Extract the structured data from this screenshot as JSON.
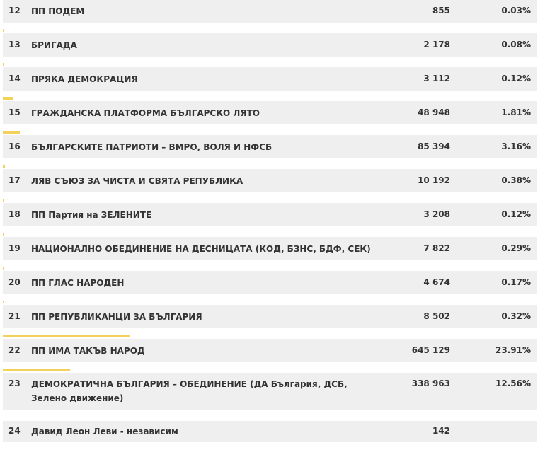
{
  "rows": [
    {
      "num": "12",
      "name": "ПП ПОДЕМ",
      "votes": "855",
      "pct": "0.03%",
      "share": 0.03
    },
    {
      "num": "13",
      "name": "БРИГАДА",
      "votes": "2 178",
      "pct": "0.08%",
      "share": 0.08
    },
    {
      "num": "14",
      "name": "ПРЯКА ДЕМОКРАЦИЯ",
      "votes": "3 112",
      "pct": "0.12%",
      "share": 0.12
    },
    {
      "num": "15",
      "name": "ГРАЖДАНСКА ПЛАТФОРМА БЪЛГАРСКО ЛЯТО",
      "votes": "48 948",
      "pct": "1.81%",
      "share": 1.81
    },
    {
      "num": "16",
      "name": "БЪЛГАРСКИТЕ ПАТРИОТИ – ВМРО, ВОЛЯ И НФСБ",
      "votes": "85 394",
      "pct": "3.16%",
      "share": 3.16
    },
    {
      "num": "17",
      "name": "ЛЯВ СЪЮЗ ЗА ЧИСТА И СВЯТА РЕПУБЛИКА",
      "votes": "10 192",
      "pct": "0.38%",
      "share": 0.38
    },
    {
      "num": "18",
      "name": "ПП Партия на ЗЕЛЕНИТЕ",
      "votes": "3 208",
      "pct": "0.12%",
      "share": 0.12
    },
    {
      "num": "19",
      "name": "НАЦИОНАЛНО ОБЕДИНЕНИЕ НА ДЕСНИЦАТА (КОД, БЗНС, БДФ, СЕК)",
      "votes": "7 822",
      "pct": "0.29%",
      "share": 0.29
    },
    {
      "num": "20",
      "name": "ПП ГЛАС НАРОДЕН",
      "votes": "4 674",
      "pct": "0.17%",
      "share": 0.17
    },
    {
      "num": "21",
      "name": "ПП РЕПУБЛИКАНЦИ ЗА БЪЛГАРИЯ",
      "votes": "8 502",
      "pct": "0.32%",
      "share": 0.32
    },
    {
      "num": "22",
      "name": "ПП ИМА ТАКЪВ НАРОД",
      "votes": "645 129",
      "pct": "23.91%",
      "share": 23.91
    },
    {
      "num": "23",
      "name": "ДЕМОКРАТИЧНА БЪЛГАРИЯ – ОБЕДИНЕНИЕ (ДА България, ДСБ, Зелено движение)",
      "votes": "338 963",
      "pct": "12.56%",
      "share": 12.56
    },
    {
      "num": "24",
      "name": "Давид Леон Леви - независим",
      "votes": "142",
      "pct": "",
      "share": null
    }
  ],
  "colors": {
    "row_bg": "#efefef",
    "bar": "#f2d25a"
  }
}
